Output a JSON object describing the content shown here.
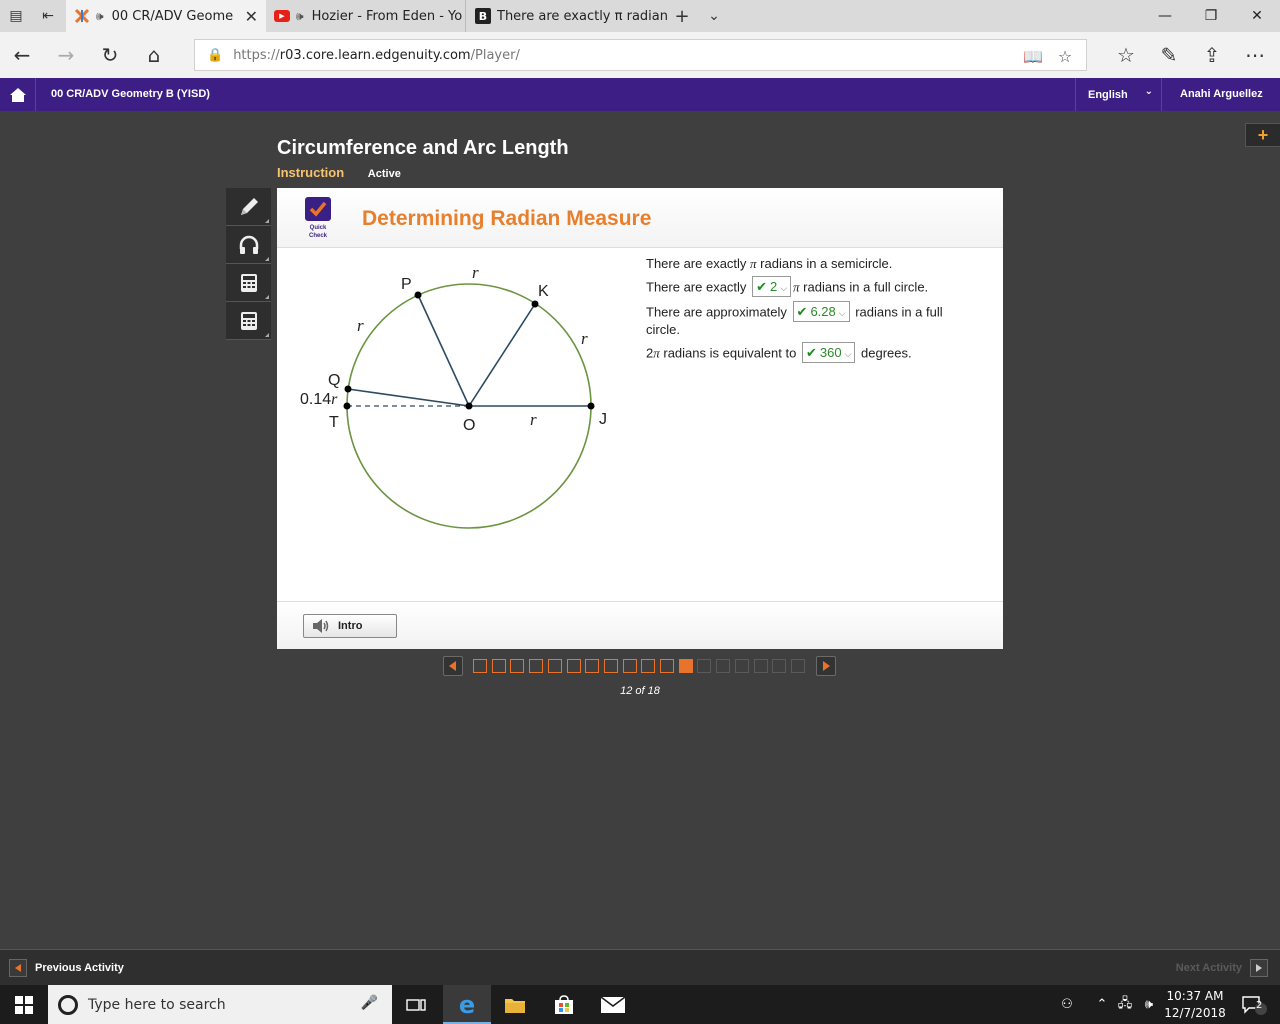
{
  "browser": {
    "tabs": [
      {
        "title": "00 CR/ADV Geome",
        "audio": true,
        "active": true
      },
      {
        "title": "Hozier - From Eden - Yo",
        "audio": true,
        "active": false
      },
      {
        "title": "There are exactly π radians",
        "audio": false,
        "active": false
      }
    ],
    "url_prefix": "https://",
    "url_host": "r03.core.learn.edgenuity.com",
    "url_path": "/Player/"
  },
  "app": {
    "course": "00 CR/ADV Geometry B (YISD)",
    "language": "English",
    "user": "Anahi Arguellez",
    "plus": "+"
  },
  "lesson": {
    "title": "Circumference and Arc Length",
    "section": "Instruction",
    "status": "Active"
  },
  "activity": {
    "badge_line1": "Quick",
    "badge_line2": "Check",
    "title": "Determining Radian Measure"
  },
  "diagram": {
    "points": {
      "P": "P",
      "K": "K",
      "Q": "Q",
      "T": "T",
      "O": "O",
      "J": "J"
    },
    "r_label": "r",
    "qt_label": "0.14"
  },
  "questions": {
    "q1_a": "There are exactly ",
    "q1_pi": "π",
    "q1_b": " radians in a semicircle.",
    "q2_a": "There are exactly",
    "q2_answer": "2",
    "q2_pi": "π",
    "q2_b": " radians in a full circle.",
    "q3_a": "There are approximately",
    "q3_answer": "6.28",
    "q3_b": "radians in a full circle.",
    "q4_two": "2",
    "q4_pi": "π",
    "q4_a": " radians is equivalent to",
    "q4_answer": "360",
    "q4_b": "degrees."
  },
  "footer": {
    "intro_label": "Intro"
  },
  "pager": {
    "total": 18,
    "current": 12,
    "count_label": "12 of 18"
  },
  "activity_nav": {
    "prev": "Previous Activity",
    "next": "Next Activity"
  },
  "taskbar": {
    "search_placeholder": "Type here to search",
    "time": "10:37 AM",
    "date": "12/7/2018",
    "notifications": "2"
  }
}
